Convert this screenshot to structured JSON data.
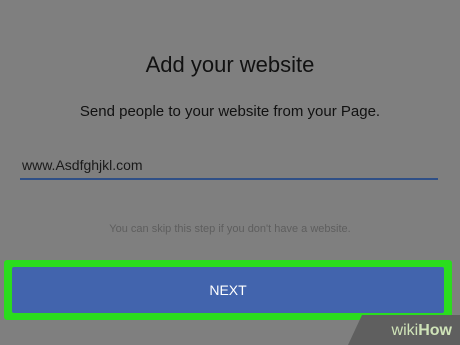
{
  "dialog": {
    "title": "Add your website",
    "subtitle": "Send people to your website from your Page.",
    "website_value": "www.Asdfghjkl.com",
    "hint": "You can skip this step if you don't have a website.",
    "next_label": "NEXT"
  },
  "watermark": {
    "part1": "wiki",
    "part2": "How"
  },
  "colors": {
    "button": "#4264ad",
    "highlight": "#2bdc1e",
    "input_underline": "#2f4f86"
  }
}
